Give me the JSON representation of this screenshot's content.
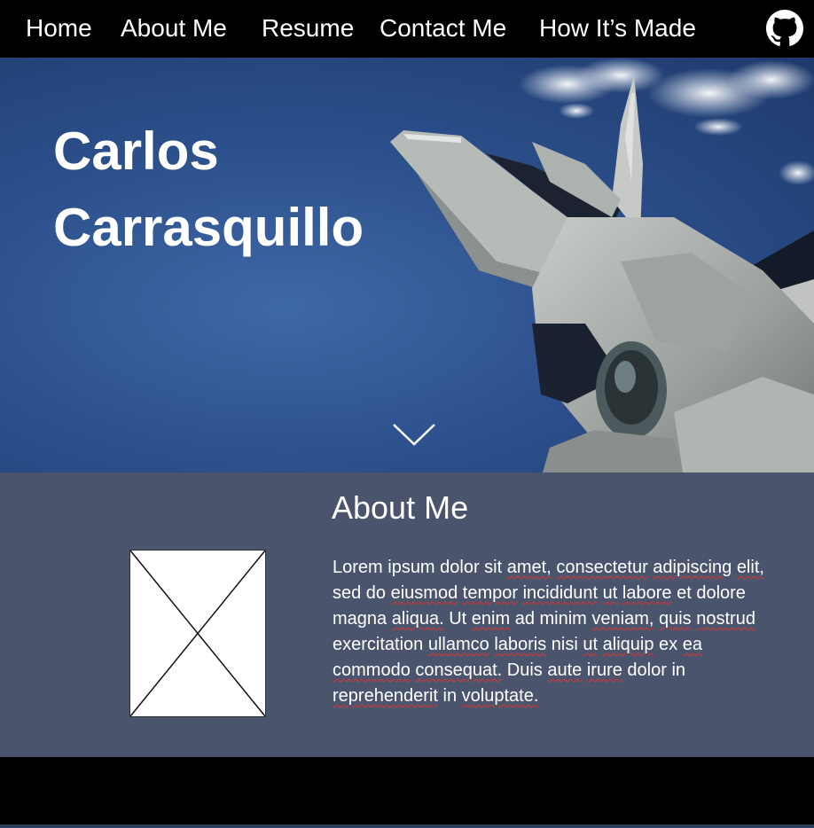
{
  "nav": {
    "items": [
      {
        "label": "Home"
      },
      {
        "label": "About Me"
      },
      {
        "label": "Resume"
      },
      {
        "label": "Contact Me"
      },
      {
        "label": "How It’s Made"
      }
    ],
    "github_icon": "github-icon"
  },
  "hero": {
    "name_line1": "Carlos",
    "name_line2": "Carrasquillo",
    "scroll_icon": "chevron-down-icon"
  },
  "about": {
    "title": "About Me",
    "image_icon": "image-placeholder-icon",
    "text_segments": [
      "Lorem ipsum dolor sit ",
      "amet,",
      " ",
      "consectetur",
      " ",
      "adipiscing",
      " ",
      "elit,",
      " sed do ",
      "eiusmod",
      " ",
      "tempor",
      " ",
      "incididunt",
      " ",
      "ut",
      " ",
      "labore",
      " et dolore magna ",
      "aliqua.",
      " Ut ",
      "enim",
      " ad minim ",
      "veniam,",
      " ",
      "quis",
      " ",
      "nostrud",
      " exercitation ",
      "ullamco",
      " ",
      "laboris",
      " nisi ",
      "ut",
      " ",
      "aliquip",
      " ex ",
      "ea",
      " ",
      "commodo",
      " ",
      "consequat.",
      " Duis ",
      "aute",
      " ",
      "irure",
      " dolor in ",
      "reprehenderit",
      " in ",
      "voluptate."
    ]
  },
  "colors": {
    "nav_bg": "#000000",
    "hero_sky": "#2c508c",
    "about_bg": "#4a556d",
    "text": "#ffffff",
    "spellcheck": "#e0312e"
  }
}
